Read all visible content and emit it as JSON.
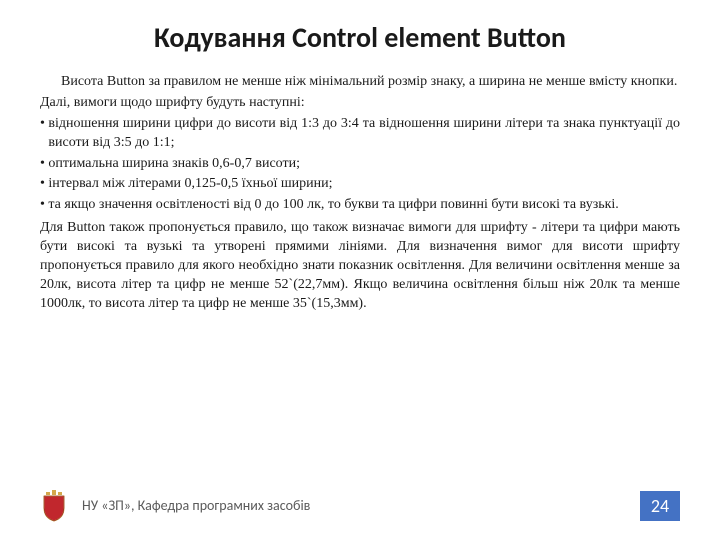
{
  "title": "Кодування Control element Button",
  "para_intro": "Висота Button за правилом не менше ніж мінімальний розмір знаку, а ширина не менше вмісту кнопки.",
  "para_lead": "Далі, вимоги щодо шрифту будуть наступні:",
  "bullets": [
    "відношення ширини цифри до висоти від 1:3 до 3:4 та відношення ширини літери та знака пунктуації до висоти від 3:5 до 1:1;",
    "оптимальна ширина знаків 0,6-0,7 висоти;",
    "інтервал між літерами 0,125-0,5 їхньої ширини;",
    "та якщо значення освітленості від 0 до 100 лк, то букви та цифри повинні бути високі та вузькі."
  ],
  "para_rule1": "Для Button також пропонується правило, що також визначає вимоги для шрифту - літери та цифри мають бути високі та вузькі та утворені прямими лініями. Для визначення вимог для висоти шрифту пропонується правило для якого необхідно знати показник освітлення. Для величини освітлення менше за 20лк, висота літер та цифр не менше 52`(22,7мм). Якщо величина освітлення більш ніж 20лк та менше 1000лк, то висота літер та цифр не менше 35`(15,3мм).",
  "footer_text": "НУ «ЗП», Кафедра програмних засобів",
  "page_number": "24",
  "colors": {
    "page_badge": "#4472c4"
  },
  "icons": {
    "crest": "crest-icon"
  }
}
